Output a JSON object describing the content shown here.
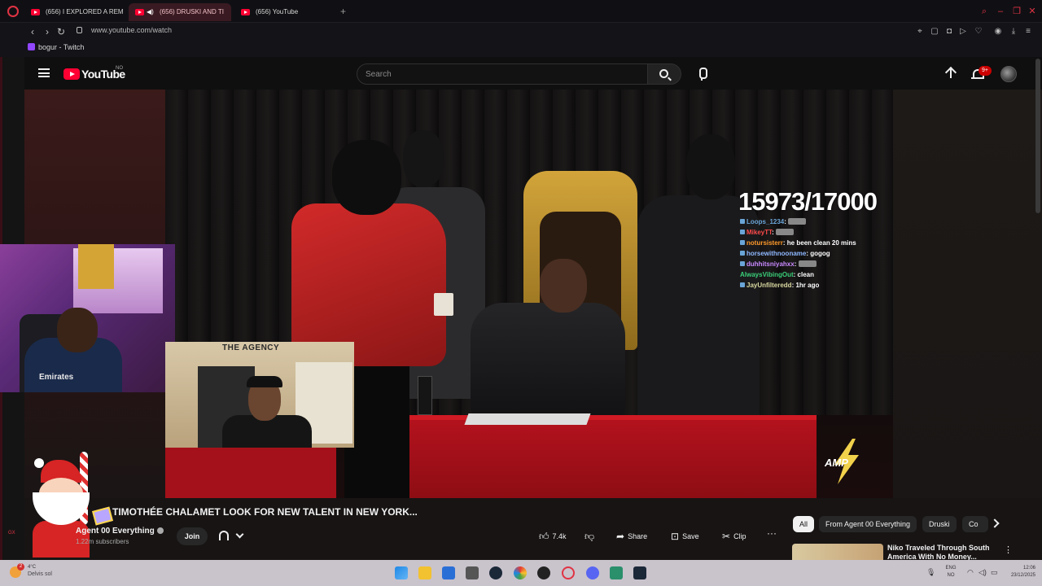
{
  "browser": {
    "tabs": [
      {
        "title": "(656) I EXPLORED A REM"
      },
      {
        "title": "(656) DRUSKI AND TI"
      },
      {
        "title": "(656) YouTube"
      }
    ],
    "new_tab_label": "+",
    "url": "www.youtube.com/watch",
    "bookmark": "bogur - Twitch",
    "nav": {
      "back": "‹",
      "forward": "›",
      "reload": "↻"
    }
  },
  "youtube": {
    "logo_text": "YouTube",
    "logo_region": "NO",
    "search_placeholder": "Search",
    "notification_count": "9+"
  },
  "overlay": {
    "counter": "15973/17000",
    "chat": [
      {
        "user": "Loops_1234",
        "message": ":",
        "color": "#6aa5d8"
      },
      {
        "user": "MikeyTT",
        "message": ":",
        "color": "#ff4a4a"
      },
      {
        "user": "notursisterr",
        "message": ": he been clean 20 mins",
        "color": "#ff9a2a"
      },
      {
        "user": "horsewithnooname",
        "message": ": gogog",
        "color": "#8fb8ff"
      },
      {
        "user": "duhhitsniyahxx",
        "message": ":",
        "color": "#c98aff"
      },
      {
        "user": "AlwaysVibingOut",
        "message": ": clean",
        "color": "#3ad07a"
      },
      {
        "user": "JayUnfilteredd",
        "message": ": 1hr ago",
        "color": "#d8d8a0"
      }
    ],
    "cam_sign": "THE AGENCY",
    "cam_logo": "Emirates",
    "amp_logo": "AMP"
  },
  "video": {
    "title": "TIMOTHÉE CHALAMET LOOK FOR NEW TALENT IN NEW YORK...",
    "channel": "Agent 00 Everything",
    "subscribers": "1.22m subscribers",
    "join_label": "Join",
    "likes": "7.4k",
    "share_label": "Share",
    "save_label": "Save",
    "clip_label": "Clip",
    "more_label": "···",
    "gx_label": "GX"
  },
  "sidebar": {
    "chips": [
      {
        "label": "All"
      },
      {
        "label": "From Agent 00 Everything"
      },
      {
        "label": "Druski"
      },
      {
        "label": "Co"
      }
    ],
    "recommended": [
      {
        "title": "Niko Traveled Through South America With No Money..."
      }
    ]
  },
  "taskbar": {
    "weather_badge": "2",
    "temp": "4°C",
    "weather_desc": "Delvis sol",
    "lang": "ENG",
    "region": "NO",
    "time": "12:06",
    "date": "23/12/2025"
  },
  "colors": {
    "accent": "#e03344",
    "youtube_red": "#ff0033",
    "background": "#0f0f0f"
  }
}
